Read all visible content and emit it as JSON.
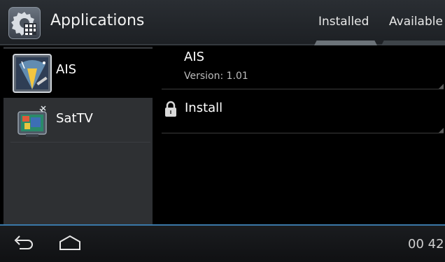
{
  "actionbar": {
    "title": "Applications",
    "icon": "settings-apps-icon",
    "tabs": [
      {
        "label": "Installed",
        "selected": true
      },
      {
        "label": "Available",
        "selected": false
      }
    ]
  },
  "sidebar": {
    "items": [
      {
        "label": "AIS",
        "icon": "ais-radar-icon",
        "selected": true
      },
      {
        "label": "SatTV",
        "icon": "sattv-icon",
        "selected": false
      }
    ]
  },
  "detail": {
    "name": "AIS",
    "version": "Version: 1.01",
    "install_label": "Install",
    "install_icon": "lock-icon"
  },
  "navbar": {
    "back_icon": "back-icon",
    "home_icon": "home-icon",
    "clock": "00 42"
  },
  "colors": {
    "actionbar_bg": "#23272b",
    "sidebar_bg": "#2e3033",
    "accent": "#3a78a8"
  }
}
